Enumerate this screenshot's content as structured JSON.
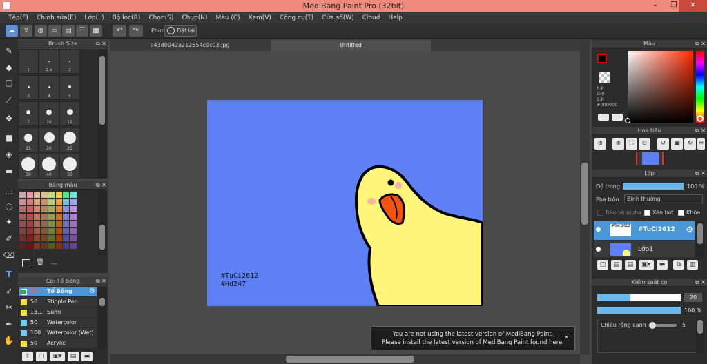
{
  "window": {
    "title": "MediBang Paint Pro (32bit)",
    "controls": [
      "–",
      "❐",
      "✕"
    ]
  },
  "menu": [
    "Tệp(F)",
    "Chỉnh sửa(E)",
    "Lớp(L)",
    "Bộ lọc(R)",
    "Chọn(S)",
    "Chụp(N)",
    "Màu (C)",
    "Xem(V)",
    "Công cụ(T)",
    "Cửa sổ(W)",
    "Cloud",
    "Help"
  ],
  "toolbar": {
    "shortcut_label": "Phím",
    "reset_label": "Đặt lại"
  },
  "brush_size": {
    "title": "Brush Size",
    "sizes": [
      "1",
      "1.5",
      "2",
      "3",
      "4",
      "5",
      "7",
      "10",
      "12",
      "15",
      "20",
      "25",
      "30",
      "40",
      "50"
    ]
  },
  "palette": {
    "title": "Bảng màu",
    "footer_label": "---"
  },
  "brush_list": {
    "title": "Cọ: Tổ Bông",
    "items": [
      {
        "size": "20",
        "name": "Tổ Bông",
        "color": "#22b14c"
      },
      {
        "size": "50",
        "name": "Stipple Pen",
        "color": "#f5e33c"
      },
      {
        "size": "13.1",
        "name": "Sumi",
        "color": "#f5e33c"
      },
      {
        "size": "50",
        "name": "Watercolor",
        "color": "#6ecff6"
      },
      {
        "size": "100",
        "name": "Watercolor (Wet)",
        "color": "#6ecff6"
      },
      {
        "size": "50",
        "name": "Acrylic",
        "color": "#f5e33c"
      }
    ]
  },
  "tabs": [
    "b43d0042a212554c0c03.jpg",
    "Untitled"
  ],
  "artwork": {
    "text_lines": [
      "#TuCi2612",
      "#Hd247"
    ]
  },
  "notice": {
    "line1": "You are not using the latest version of MediBang Paint.",
    "line2": "Please install the latest version of MediBang Paint found here."
  },
  "color_panel": {
    "title": "Màu",
    "r": "R:0",
    "g": "G:0",
    "b": "B:0",
    "hex": "#000000"
  },
  "navigator": {
    "title": "Hoa tiêu"
  },
  "layers": {
    "title": "Lớp",
    "opacity_label": "Độ trong",
    "opacity_value": "100 %",
    "opacity_fraction": 1.0,
    "blend_label": "Pha trộn",
    "blend_value": "Bình thường",
    "protect_alpha": "Bảo vệ alpha",
    "clipping": "Xén bớt",
    "lock": "Khóa",
    "items": [
      {
        "name": "#TuCi2612",
        "thumb_text": "#TuCi2612"
      },
      {
        "name": "Lớp1"
      }
    ]
  },
  "brush_control": {
    "title": "Kiểm soát cọ",
    "size_value": "20",
    "size_fraction": 0.4,
    "opacity_value": "100 %",
    "opacity_fraction": 1.0,
    "edge_label": "Chiều rộng cạnh",
    "edge_value": "5"
  }
}
